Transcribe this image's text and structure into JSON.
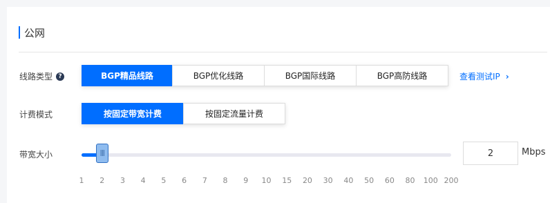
{
  "section": {
    "title": "公网"
  },
  "route_type": {
    "label": "线路类型",
    "help_icon": "question-circle-icon",
    "options": [
      "BGP精品线路",
      "BGP优化线路",
      "BGP国际线路",
      "BGP高防线路"
    ],
    "selected_index": 0,
    "link_label": "查看测试IP"
  },
  "billing": {
    "label": "计费模式",
    "options": [
      "按固定带宽计费",
      "按固定流量计费"
    ],
    "selected_index": 0
  },
  "bandwidth": {
    "label": "带宽大小",
    "value": "2",
    "unit": "Mbps",
    "handle_glyph": "|||",
    "ticks": [
      "1",
      "2",
      "3",
      "4",
      "5",
      "6",
      "7",
      "8",
      "9",
      "10",
      "15",
      "20",
      "30",
      "40",
      "50",
      "60",
      "80",
      "100",
      "200"
    ]
  },
  "colors": {
    "accent": "#006eff",
    "handle": "#8fbcef"
  }
}
